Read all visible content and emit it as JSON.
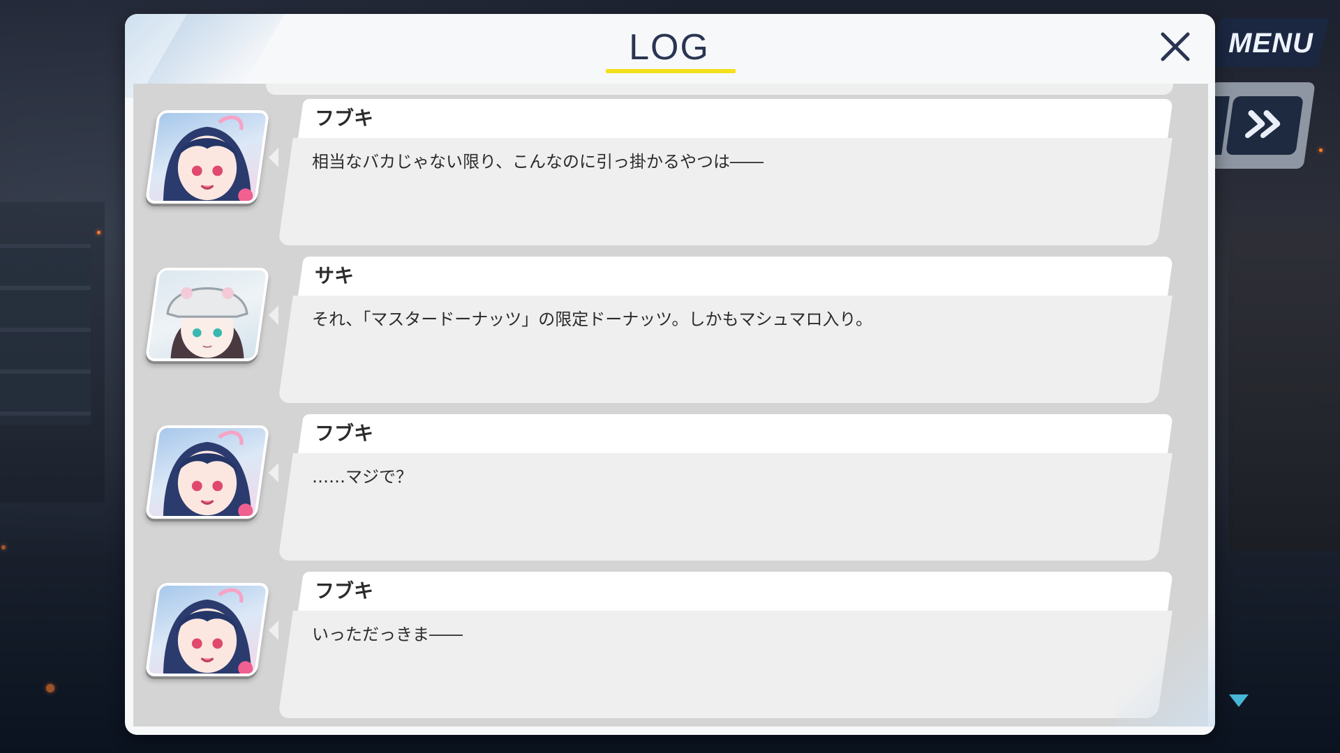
{
  "hud": {
    "menu_label": "MENU",
    "scroll_hint": "down-triangle"
  },
  "log": {
    "title": "LOG",
    "entries": [
      {
        "speaker": "フブキ",
        "avatar": "fubuki-portrait",
        "text": "相当なバカじゃない限り、こんなのに引っ掛かるやつは――"
      },
      {
        "speaker": "サキ",
        "avatar": "saki-portrait",
        "text": "それ、「マスタードーナッツ」の限定ドーナッツ。しかもマシュマロ入り。"
      },
      {
        "speaker": "フブキ",
        "avatar": "fubuki-portrait",
        "text": "……マジで？"
      },
      {
        "speaker": "フブキ",
        "avatar": "fubuki-portrait",
        "text": "いっただっきま――"
      }
    ]
  },
  "colors": {
    "title_text": "#2a3552",
    "title_underline": "#f3e01c",
    "hud_dark": "#1e2a40",
    "bubble_bg": "#efefef",
    "list_bg": "#d4d4d4",
    "scroll_arrow": "#48b6d6"
  },
  "icons": {
    "close": "close-icon",
    "skip": "fast-forward-icon"
  }
}
